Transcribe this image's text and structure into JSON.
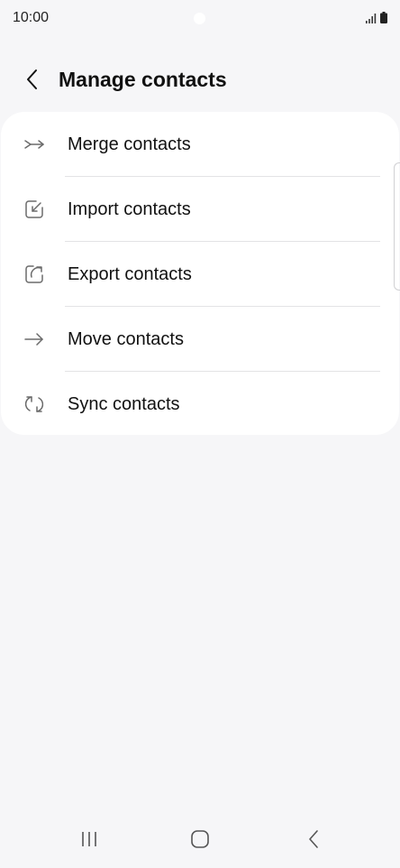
{
  "status_bar": {
    "time": "10:00"
  },
  "header": {
    "title": "Manage contacts",
    "back_icon": "chevron-left-icon"
  },
  "menu": {
    "items": [
      {
        "label": "Merge contacts",
        "icon": "merge-icon"
      },
      {
        "label": "Import contacts",
        "icon": "import-icon"
      },
      {
        "label": "Export contacts",
        "icon": "export-icon"
      },
      {
        "label": "Move contacts",
        "icon": "arrow-right-icon"
      },
      {
        "label": "Sync contacts",
        "icon": "sync-icon"
      }
    ]
  },
  "nav_bar": {
    "recents_icon": "recents-icon",
    "home_icon": "home-icon",
    "back_icon": "back-icon"
  },
  "colors": {
    "background": "#f6f6f8",
    "card": "#ffffff",
    "icon": "#6b6b6b",
    "text": "#111111",
    "divider": "#e3e3e5"
  }
}
